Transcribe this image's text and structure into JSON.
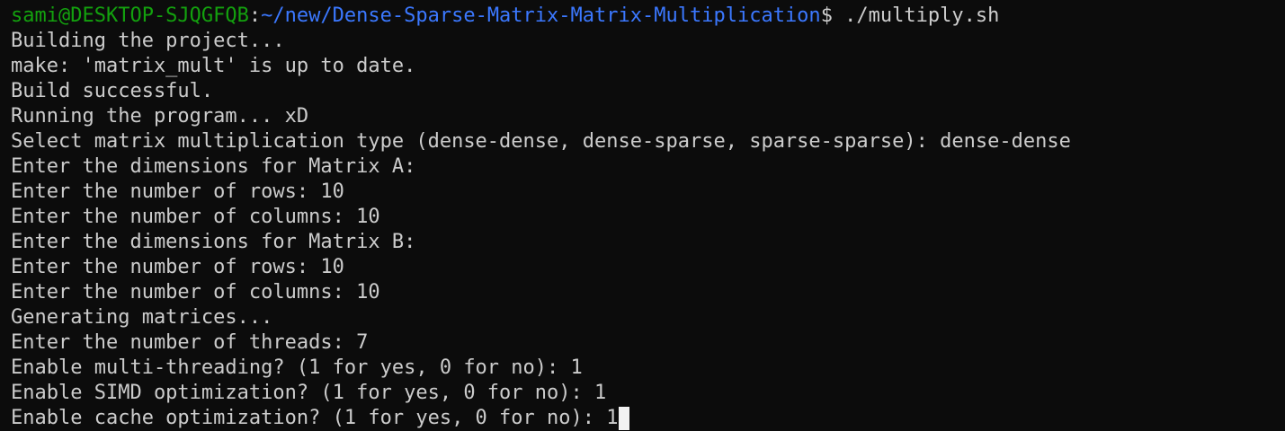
{
  "prompt": {
    "user_host": "sami@DESKTOP-SJQGFQB",
    "separator": ":",
    "path": "~/new/Dense-Sparse-Matrix-Matrix-Multiplication",
    "symbol": "$",
    "command": " ./multiply.sh"
  },
  "output_lines": [
    "Building the project...",
    "make: 'matrix_mult' is up to date.",
    "Build successful.",
    "Running the program... xD",
    "Select matrix multiplication type (dense-dense, dense-sparse, sparse-sparse): dense-dense",
    "Enter the dimensions for Matrix A:",
    "Enter the number of rows: 10",
    "Enter the number of columns: 10",
    "Enter the dimensions for Matrix B:",
    "Enter the number of rows: 10",
    "Enter the number of columns: 10",
    "Generating matrices...",
    "Enter the number of threads: 7",
    "Enable multi-threading? (1 for yes, 0 for no): 1",
    "Enable SIMD optimization? (1 for yes, 0 for no): 1",
    "Enable cache optimization? (1 for yes, 0 for no): 1"
  ],
  "colors": {
    "background": "#0c0c0c",
    "text": "#cccccc",
    "user_host": "#13a10e",
    "path": "#3b78ff",
    "cursor": "#f2f2f2"
  }
}
